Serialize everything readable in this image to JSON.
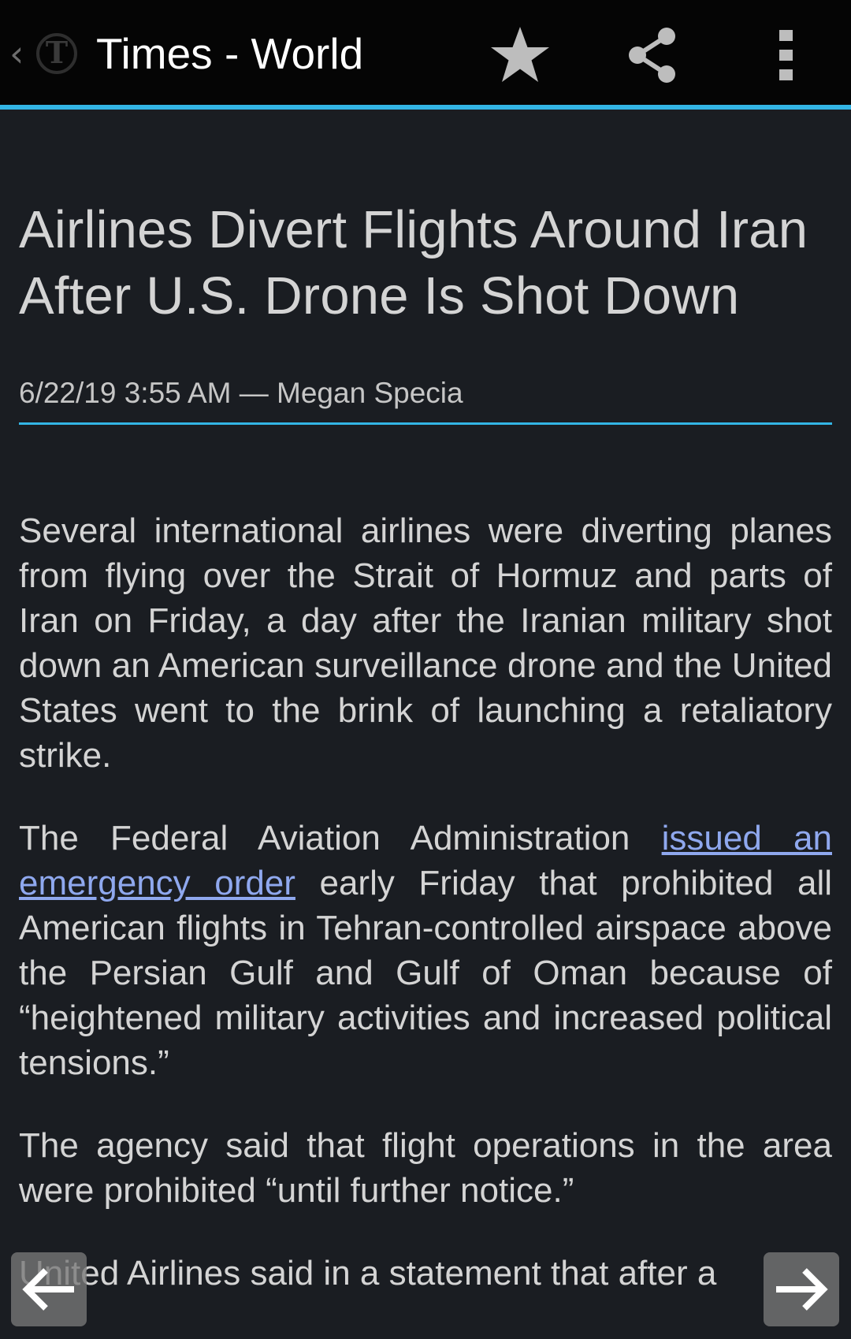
{
  "actionbar": {
    "title": "Times - World",
    "up_caret": "‹",
    "icons": {
      "logo": "nyt-logo-icon",
      "favorite": "star-icon",
      "share": "share-icon",
      "overflow": "overflow-menu-icon"
    },
    "accent_color": "#33b5e5"
  },
  "article": {
    "headline": "Airlines Divert Flights Around Iran After U.S. Drone Is Shot Down",
    "byline": "6/22/19 3:55 AM — Megan Specia",
    "paragraph_1": "Several international airlines were diverting planes from flying over the Strait of Hormuz and parts of Iran on Friday, a day after the Iranian military shot down an American surveillance drone and the United States went to the brink of launching a retaliatory strike.",
    "paragraph_2_before": "The Federal Aviation Administration ",
    "paragraph_2_link": "issued an emergency order",
    "paragraph_2_after": " early Friday that prohibited all American flights in Tehran-controlled airspace above the Persian Gulf and Gulf of Oman because of “heightened military activities and increased political tensions.”",
    "paragraph_3": "The agency said that flight operations in the area were prohibited “until further notice.”",
    "paragraph_4": "United Airlines said in a statement that after a"
  },
  "navigation": {
    "previous": "arrow-left-icon",
    "next": "arrow-right-icon"
  },
  "colors": {
    "background": "#1a1d22",
    "text": "#d4d4d4",
    "link": "#8fa8ee"
  }
}
